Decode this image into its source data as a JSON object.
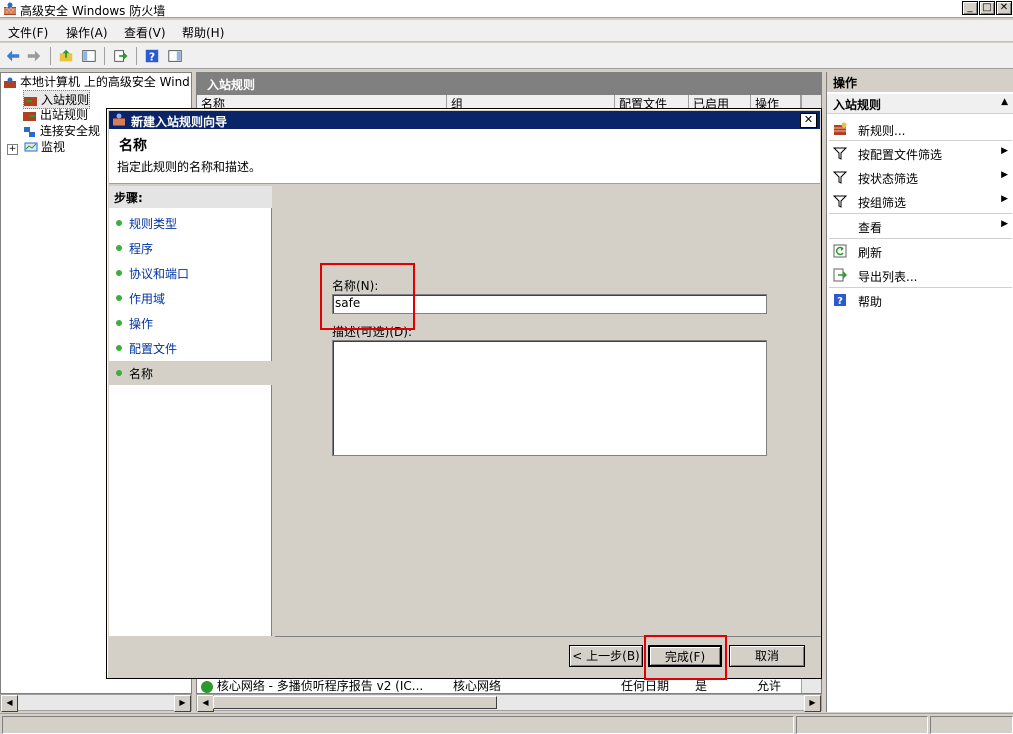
{
  "window": {
    "title": "高级安全 Windows 防火墙"
  },
  "menu": [
    "文件(F)",
    "操作(A)",
    "查看(V)",
    "帮助(H)"
  ],
  "tree": {
    "root": "本地计算机 上的高级安全 Wind",
    "items": [
      "入站规则",
      "出站规则",
      "连接安全规",
      "监视"
    ]
  },
  "center": {
    "title": "入站规则",
    "columns": [
      "名称",
      "组",
      "配置文件",
      "已启用",
      "操作"
    ],
    "bottom_row": {
      "name": "核心网络 - 多播侦听程序报告 v2 (IC...",
      "group": "核心网络",
      "profile": "任何日期",
      "enabled": "是",
      "action": "允许"
    }
  },
  "actions": {
    "title": "操作",
    "section": "入站规则",
    "items": [
      {
        "label": "新规则...",
        "icon": "new-rule-icon",
        "submenu": false
      },
      {
        "label": "按配置文件筛选",
        "icon": "filter-icon",
        "submenu": true
      },
      {
        "label": "按状态筛选",
        "icon": "filter-icon",
        "submenu": true
      },
      {
        "label": "按组筛选",
        "icon": "filter-icon",
        "submenu": true
      },
      {
        "label": "查看",
        "icon": "",
        "submenu": true
      },
      {
        "label": "刷新",
        "icon": "refresh-icon",
        "submenu": false
      },
      {
        "label": "导出列表...",
        "icon": "export-icon",
        "submenu": false
      },
      {
        "label": "帮助",
        "icon": "help-icon",
        "submenu": false
      }
    ]
  },
  "wizard": {
    "title": "新建入站规则向导",
    "heading": "名称",
    "subheading": "指定此规则的名称和描述。",
    "steps_title": "步骤:",
    "steps": [
      "规则类型",
      "程序",
      "协议和端口",
      "作用域",
      "操作",
      "配置文件",
      "名称"
    ],
    "current_step": "名称",
    "name_label": "名称(N):",
    "name_value": "safe",
    "desc_label": "描述(可选)(D):",
    "desc_value": "",
    "buttons": {
      "back": "< 上一步(B)",
      "finish": "完成(F)",
      "cancel": "取消"
    }
  },
  "colors": {
    "title_active": "#0a246a",
    "highlight_box": "#e00000",
    "step_dot": "#3cae3c",
    "step_link": "#0033a0"
  }
}
